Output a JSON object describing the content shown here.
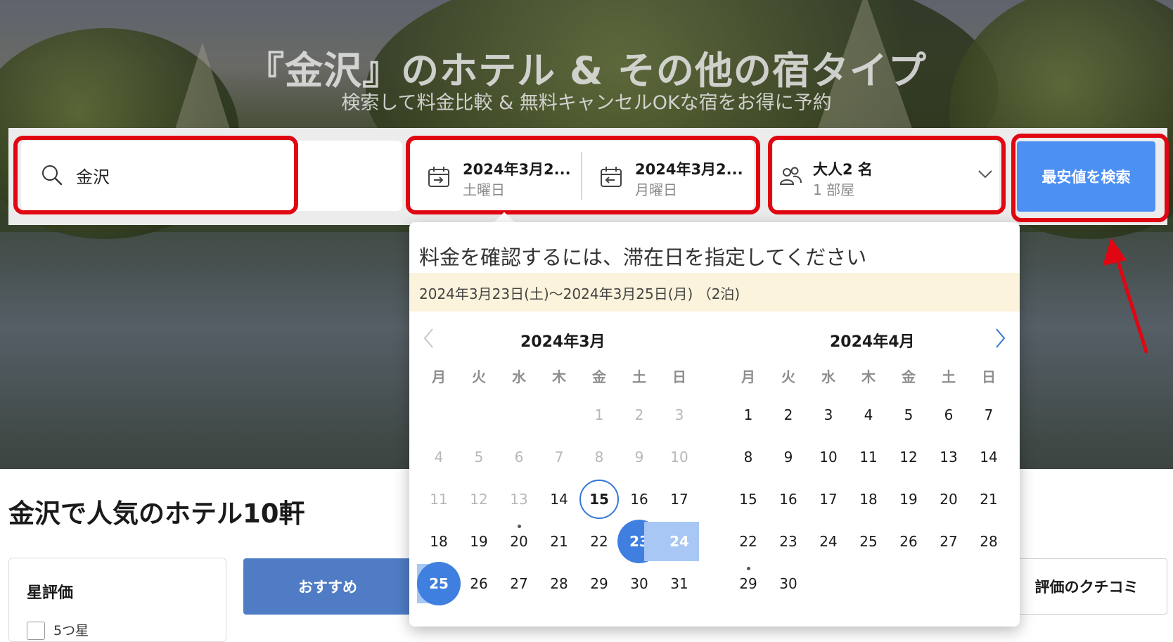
{
  "hero": {
    "title": "『金沢』のホテル & その他の宿タイプ",
    "subtitle": "検索して料金比較 & 無料キャンセルOKな宿をお得に予約"
  },
  "search": {
    "destination_value": "金沢",
    "checkin_date": "2024年3月2...",
    "checkin_day": "土曜日",
    "checkout_date": "2024年3月2...",
    "checkout_day": "月曜日",
    "guests": "大人2 名",
    "rooms": "1 部屋",
    "search_button": "最安値を検索"
  },
  "calendar": {
    "prompt": "料金を確認するには、滞在日を指定してください",
    "range_text": "2024年3月23日(土)〜2024年3月25日(月) （2泊)",
    "weekdays": [
      "月",
      "火",
      "水",
      "木",
      "金",
      "土",
      "日"
    ],
    "months": [
      {
        "title": "2024年3月",
        "rows": [
          [
            "",
            "",
            "",
            "",
            "1",
            "2",
            "3"
          ],
          [
            "4",
            "5",
            "6",
            "7",
            "8",
            "9",
            "10"
          ],
          [
            "11",
            "12",
            "13",
            "14",
            "15",
            "16",
            "17"
          ],
          [
            "18",
            "19",
            "20",
            "21",
            "22",
            "23",
            "24"
          ],
          [
            "25",
            "26",
            "27",
            "28",
            "29",
            "30",
            "31"
          ]
        ]
      },
      {
        "title": "2024年4月",
        "rows": [
          [
            "1",
            "2",
            "3",
            "4",
            "5",
            "6",
            "7"
          ],
          [
            "8",
            "9",
            "10",
            "11",
            "12",
            "13",
            "14"
          ],
          [
            "15",
            "16",
            "17",
            "18",
            "19",
            "20",
            "21"
          ],
          [
            "22",
            "23",
            "24",
            "25",
            "26",
            "27",
            "28"
          ],
          [
            "29",
            "30",
            "",
            "",
            "",
            "",
            ""
          ]
        ]
      }
    ],
    "disabled_march_through": 13,
    "today": "15",
    "checkin": "23",
    "checkout": "25"
  },
  "results": {
    "heading": "金沢で人気のホテル10軒",
    "filter_title": "星評価",
    "filter_option": "5つ星",
    "tab_recommended": "おすすめ",
    "tab_reviews": "評価のクチコミ"
  },
  "colors": {
    "accent": "#4c90f3",
    "highlight_border": "#e00612",
    "range_band": "#a9c7f4",
    "notice_bg": "#fcf3dc"
  }
}
